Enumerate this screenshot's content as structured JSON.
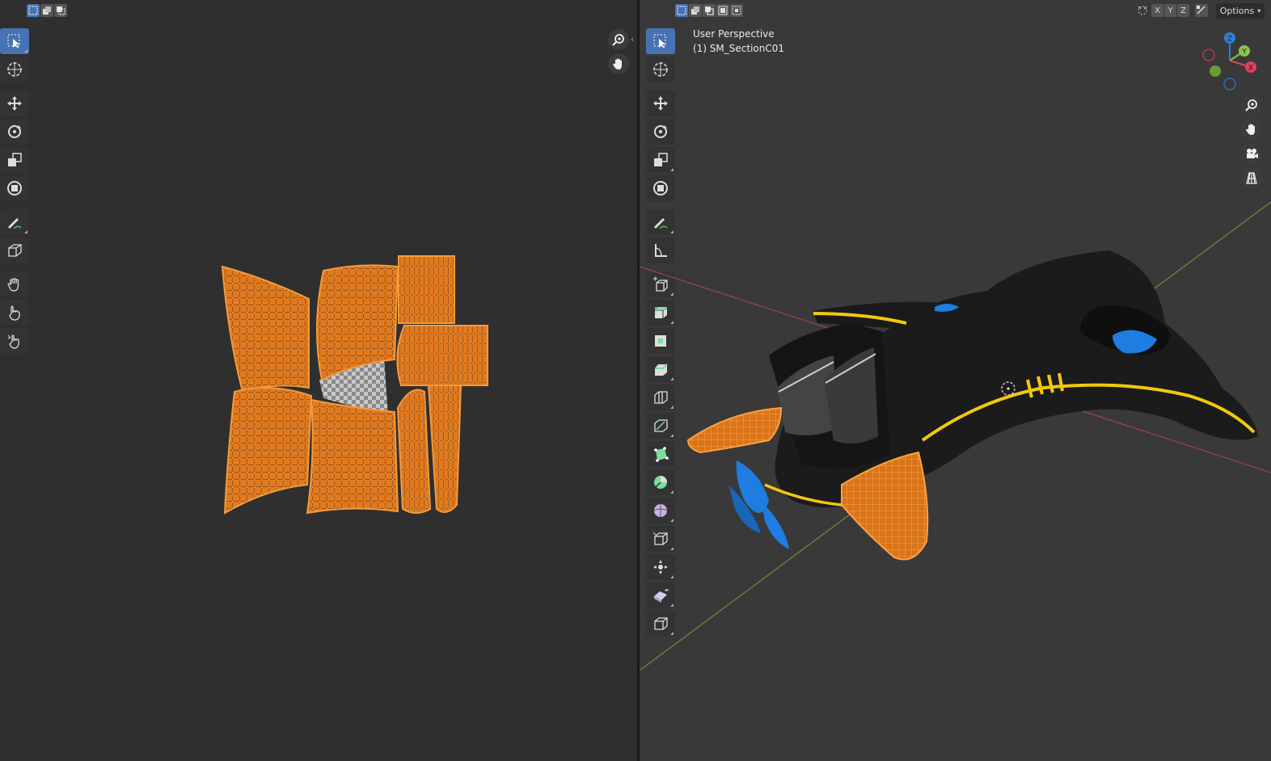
{
  "uv_editor": {
    "header": {
      "select_modes": [
        "vertex-select",
        "edge-select",
        "face-select"
      ]
    },
    "tools": [
      "select-box",
      "cursor",
      "move",
      "rotate",
      "scale",
      "transform",
      "annotate",
      "cube",
      "grab",
      "relax",
      "pinch"
    ],
    "nav": [
      "zoom-icon",
      "hand-icon"
    ]
  },
  "viewport": {
    "header": {
      "select_modes": [
        "mode-1",
        "mode-2",
        "mode-3",
        "mode-4",
        "mode-5"
      ],
      "axes": [
        "X",
        "Y",
        "Z"
      ],
      "options_label": "Options"
    },
    "overlay": {
      "perspective": "User Perspective",
      "object": "(1) SM_SectionC01"
    },
    "gizmo": {
      "z_label": "Z",
      "y_label": "Y",
      "x_label": "X",
      "colors": {
        "x": "#e0405a",
        "y": "#8bc34a",
        "z": "#2e80d6"
      }
    },
    "tools": [
      "select-box",
      "cursor",
      "move",
      "rotate",
      "scale",
      "transform",
      "annotate",
      "measure",
      "add-cube",
      "extrude",
      "inset",
      "bevel",
      "loop-cut",
      "knife",
      "poly-build",
      "spin",
      "smooth",
      "edge-slide",
      "shrink",
      "shear",
      "rip"
    ],
    "nav": [
      "zoom-icon",
      "hand-icon",
      "camera-icon",
      "grid-icon"
    ]
  },
  "colors": {
    "selection_orange": "#f08a24",
    "accent_blue": "#4772b3",
    "ship_yellow": "#f2c80f",
    "ship_blue": "#1f7ce0"
  }
}
